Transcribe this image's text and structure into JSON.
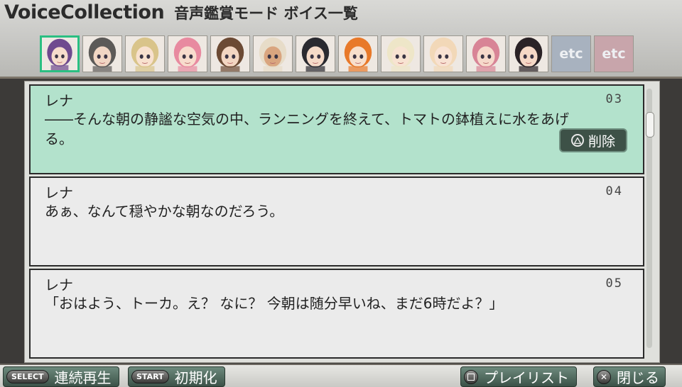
{
  "header": {
    "title_en": "VoiceCollection",
    "title_jp": "音声鑑賞モード ボイス一覧"
  },
  "characters": [
    {
      "icon": "character-portrait-1",
      "selected": true,
      "hair": "#6f4a8f",
      "skin": "#f6dccc"
    },
    {
      "icon": "character-portrait-2",
      "selected": false,
      "hair": "#5c5a58",
      "skin": "#f1d6c4"
    },
    {
      "icon": "character-portrait-3",
      "selected": false,
      "hair": "#d9c48a",
      "skin": "#f8e1cf"
    },
    {
      "icon": "character-portrait-4",
      "selected": false,
      "hair": "#e88aa0",
      "skin": "#f8dccd"
    },
    {
      "icon": "character-portrait-5",
      "selected": false,
      "hair": "#6c4a34",
      "skin": "#f3d6c2"
    },
    {
      "icon": "character-portrait-6",
      "selected": false,
      "hair": "#e7dcc8",
      "skin": "#d9a57f"
    },
    {
      "icon": "character-portrait-7",
      "selected": false,
      "hair": "#2a2a30",
      "skin": "#f5dac8"
    },
    {
      "icon": "character-portrait-8",
      "selected": false,
      "hair": "#e8792a",
      "skin": "#f8dfcc"
    },
    {
      "icon": "character-portrait-9",
      "selected": false,
      "hair": "#eee6c8",
      "skin": "#f8e3d2"
    },
    {
      "icon": "character-portrait-10",
      "selected": false,
      "hair": "#f2d8b8",
      "skin": "#f8e2d3"
    },
    {
      "icon": "character-portrait-11",
      "selected": false,
      "hair": "#d88496",
      "skin": "#f6d9cb"
    },
    {
      "icon": "character-portrait-12",
      "selected": false,
      "hair": "#2a2226",
      "skin": "#f5d8c6"
    }
  ],
  "etc_tabs": [
    "etc",
    "etc"
  ],
  "entries": [
    {
      "speaker": "レナ",
      "number": "03",
      "text": "――そんな朝の静謐な空気の中、ランニングを終えて、トマトの鉢植えに水をあげる。",
      "selected": true
    },
    {
      "speaker": "レナ",
      "number": "04",
      "text": "あぁ、なんて穏やかな朝なのだろう。",
      "selected": false
    },
    {
      "speaker": "レナ",
      "number": "05",
      "text": "「おはよう、トーカ。え？ なに？ 今朝は随分早いね、まだ6時だよ？」",
      "selected": false
    }
  ],
  "delete_label": "削除",
  "delete_icon": "triangle-button-icon",
  "bottom": {
    "select_pill": "SELECT",
    "select_label": "連続再生",
    "start_pill": "START",
    "start_label": "初期化",
    "playlist_icon": "square-button-icon",
    "playlist_label": "プレイリスト",
    "close_icon": "cross-button-icon",
    "close_label": "閉じる"
  },
  "colors": {
    "selected_row": "#b3e2cc",
    "row": "#ebebeb",
    "accent": "#2bbf82"
  }
}
